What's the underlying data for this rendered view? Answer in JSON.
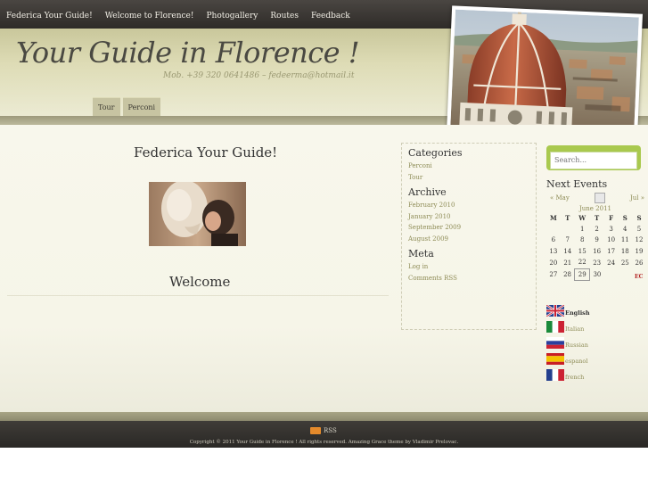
{
  "nav": {
    "items": [
      "Federica Your Guide!",
      "Welcome to Florence!",
      "Photogallery",
      "Routes",
      "Feedback"
    ]
  },
  "header": {
    "title": "Your Guide in Florence !",
    "subtitle": "Mob. +39 320 0641486 – fedeerma@hotmail.it",
    "subnav": [
      "Tour",
      "Perconi"
    ]
  },
  "post": {
    "title": "Federica Your Guide!",
    "welcome": "Welcome"
  },
  "sidebar": {
    "categories_title": "Categories",
    "categories": [
      "Perconi",
      "Tour"
    ],
    "archive_title": "Archive",
    "archive": [
      "February 2010",
      "January 2010",
      "September 2009",
      "August 2009"
    ],
    "meta_title": "Meta",
    "meta": [
      "Log in",
      "Comments RSS"
    ]
  },
  "search": {
    "placeholder": "Search..."
  },
  "events": {
    "title": "Next Events",
    "prev": "« May",
    "next": "Jul »",
    "month": "June 2011",
    "weekdays": [
      "M",
      "T",
      "W",
      "T",
      "F",
      "S",
      "S"
    ],
    "weeks": [
      [
        "",
        "",
        "1",
        "2",
        "3",
        "4",
        "5"
      ],
      [
        "6",
        "7",
        "8",
        "9",
        "10",
        "11",
        "12"
      ],
      [
        "13",
        "14",
        "15",
        "16",
        "17",
        "18",
        "19"
      ],
      [
        "20",
        "21",
        "22",
        "23",
        "24",
        "25",
        "26"
      ],
      [
        "27",
        "28",
        "29",
        "30",
        "",
        "",
        ""
      ]
    ],
    "today": "29",
    "ec_label": "EC"
  },
  "languages": [
    {
      "label": "English",
      "flag": "uk-flag-icon",
      "selected": true
    },
    {
      "label": "Italian",
      "flag": "italy-flag-icon",
      "selected": false
    },
    {
      "label": "Russian",
      "flag": "russia-flag-icon",
      "selected": false
    },
    {
      "label": "espanol",
      "flag": "spain-flag-icon",
      "selected": false
    },
    {
      "label": "french",
      "flag": "france-flag-icon",
      "selected": false
    }
  ],
  "footer": {
    "rss": "RSS",
    "copyright": "Copyright © 2011 Your Guide in Florence ! All rights reserved. Amazing Grace theme by Vladimir Prelovac."
  },
  "colors": {
    "accent": "#8d8b55",
    "search_frame": "#a9c94e",
    "topbar": "#3a3733"
  }
}
